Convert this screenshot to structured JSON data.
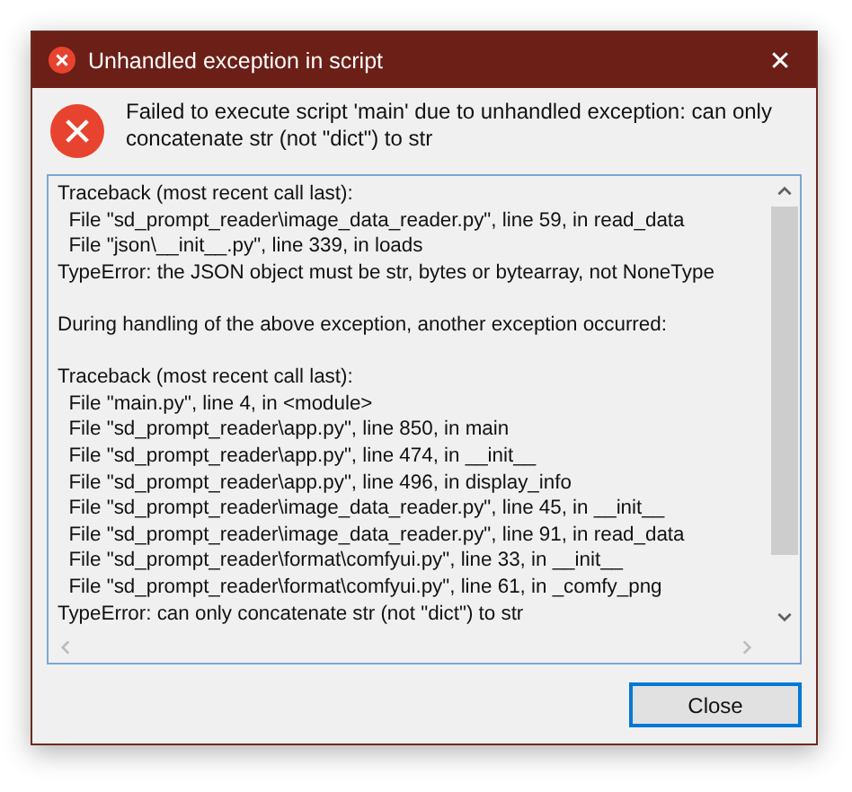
{
  "window": {
    "title": "Unhandled exception in script",
    "close_glyph": "✕"
  },
  "message": "Failed to execute script 'main' due to unhandled exception: can only concatenate str (not \"dict\") to str",
  "traceback_blocks": [
    {
      "lines": [
        "Traceback (most recent call last):",
        "  File \"sd_prompt_reader\\image_data_reader.py\", line 59, in read_data",
        "  File \"json\\__init__.py\", line 339, in loads",
        "TypeError: the JSON object must be str, bytes or bytearray, not NoneType"
      ]
    },
    {
      "lines": [
        "During handling of the above exception, another exception occurred:"
      ]
    },
    {
      "lines": [
        "Traceback (most recent call last):",
        "  File \"main.py\", line 4, in <module>",
        "  File \"sd_prompt_reader\\app.py\", line 850, in main",
        "  File \"sd_prompt_reader\\app.py\", line 474, in __init__",
        "  File \"sd_prompt_reader\\app.py\", line 496, in display_info",
        "  File \"sd_prompt_reader\\image_data_reader.py\", line 45, in __init__",
        "  File \"sd_prompt_reader\\image_data_reader.py\", line 91, in read_data",
        "  File \"sd_prompt_reader\\format\\comfyui.py\", line 33, in __init__",
        "  File \"sd_prompt_reader\\format\\comfyui.py\", line 61, in _comfy_png",
        "TypeError: can only concatenate str (not \"dict\") to str"
      ]
    }
  ],
  "buttons": [
    {
      "label": "Close"
    }
  ]
}
